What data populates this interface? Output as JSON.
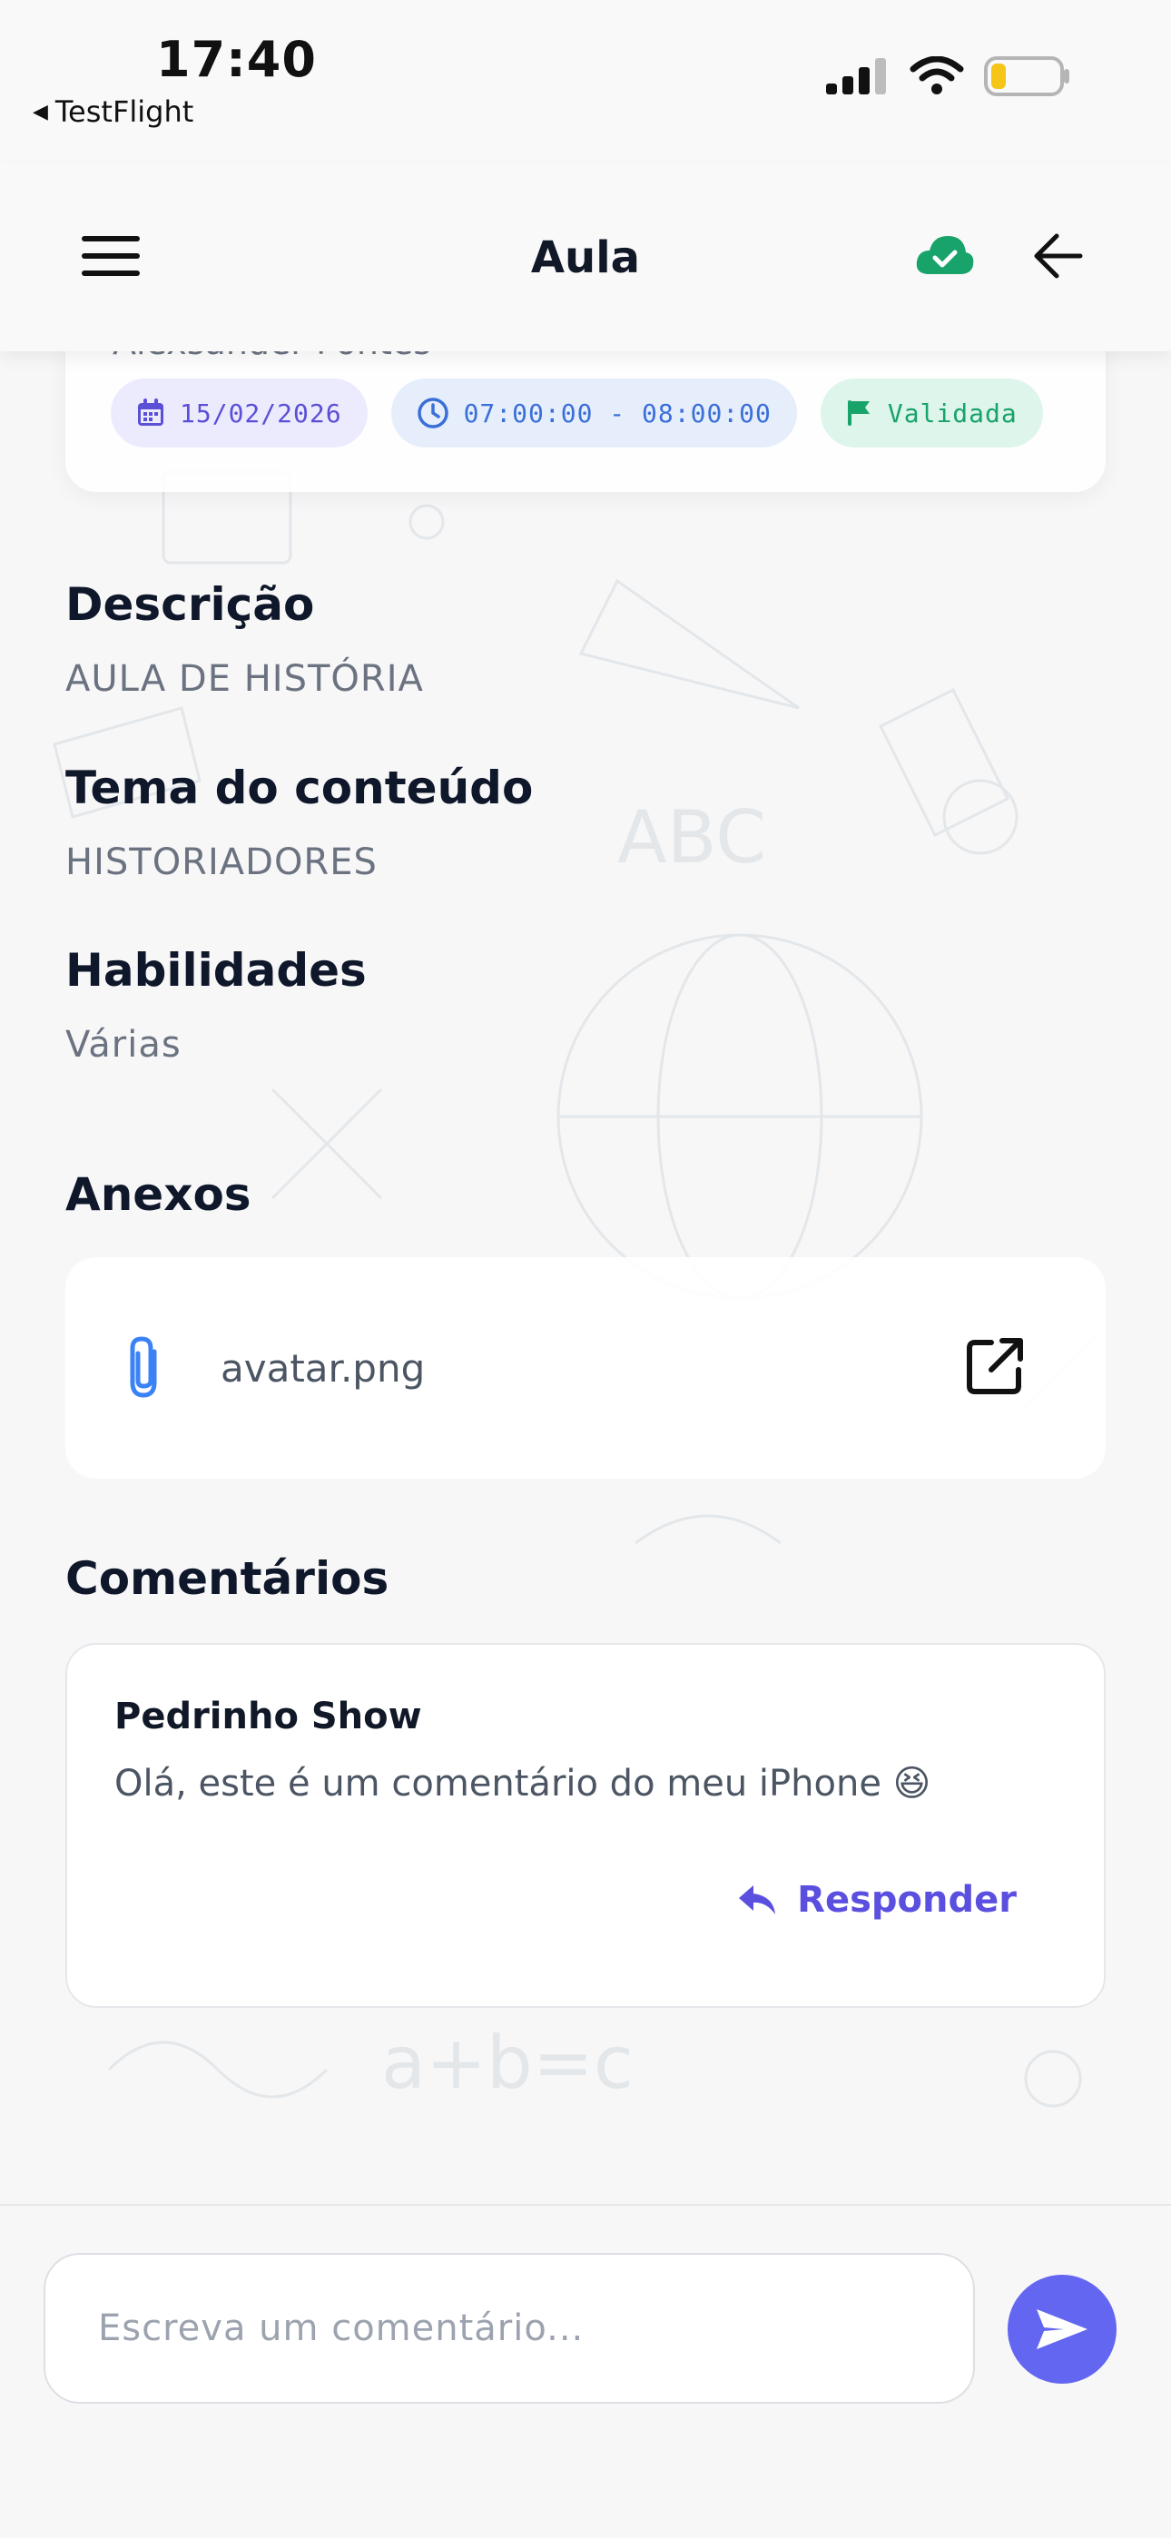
{
  "status_bar": {
    "time": "17:40",
    "back_app": "TestFlight"
  },
  "header": {
    "title": "Aula"
  },
  "lesson": {
    "teacher": "Alexsander Pontes",
    "date": "15/02/2026",
    "time_range": "07:00:00 - 08:00:00",
    "status": "Validada"
  },
  "sections": {
    "description_label": "Descrição",
    "description_value": "AULA DE HISTÓRIA",
    "theme_label": "Tema do conteúdo",
    "theme_value": "HISTORIADORES",
    "skills_label": "Habilidades",
    "skills_value": "Várias"
  },
  "attachments": {
    "label": "Anexos",
    "items": [
      {
        "filename": "avatar.png"
      }
    ]
  },
  "comments": {
    "label": "Comentários",
    "items": [
      {
        "author": "Pedrinho Show",
        "text": "Olá, este é um comentário do meu iPhone 😆",
        "reply_label": "Responder"
      }
    ]
  },
  "composer": {
    "placeholder": "Escreva um comentário..."
  },
  "colors": {
    "accent": "#6366f1",
    "success": "#18a36b",
    "chip_date_bg": "#ecebfd",
    "chip_time_bg": "#e6eefc",
    "chip_status_bg": "#ddf5ea"
  },
  "icons": {
    "menu": "hamburger-icon",
    "sync": "cloud-check-icon",
    "back": "arrow-left-icon",
    "date": "calendar-icon",
    "time": "clock-icon",
    "status": "flag-icon",
    "attachment": "paperclip-icon",
    "open": "external-link-icon",
    "reply": "reply-icon",
    "send": "send-icon"
  }
}
